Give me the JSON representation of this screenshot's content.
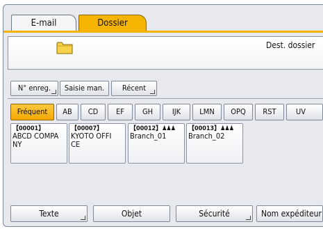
{
  "tabs": [
    {
      "label": "E-mail",
      "selected": false
    },
    {
      "label": "Dossier",
      "selected": true
    }
  ],
  "destination": {
    "label": "Dest. dossier",
    "icon": "folder-icon"
  },
  "entry_buttons": {
    "reg_no": "N° enreg.",
    "manual": "Saisie man.",
    "recent": "Récent"
  },
  "index_tabs": [
    "Fréquent",
    "AB",
    "CD",
    "EF",
    "GH",
    "IJK",
    "LMN",
    "OPQ",
    "RST",
    "UV"
  ],
  "destinations": [
    {
      "number": "【00001】",
      "name_line1": "ABCD COMPA",
      "name_line2": "NY",
      "group": false
    },
    {
      "number": "【00007】",
      "name_line1": "KYOTO OFFI",
      "name_line2": "CE",
      "group": false
    },
    {
      "number": "【00012】",
      "name_line1": "Branch_01",
      "name_line2": "",
      "group": true
    },
    {
      "number": "【00013】",
      "name_line1": "Branch_02",
      "name_line2": "",
      "group": true
    }
  ],
  "bottom_buttons": {
    "text": "Texte",
    "object": "Objet",
    "security": "Sécurité",
    "sender": "Nom expéditeur"
  },
  "colors": {
    "accent": "#f4b400",
    "frame": "#e7e9ee"
  }
}
